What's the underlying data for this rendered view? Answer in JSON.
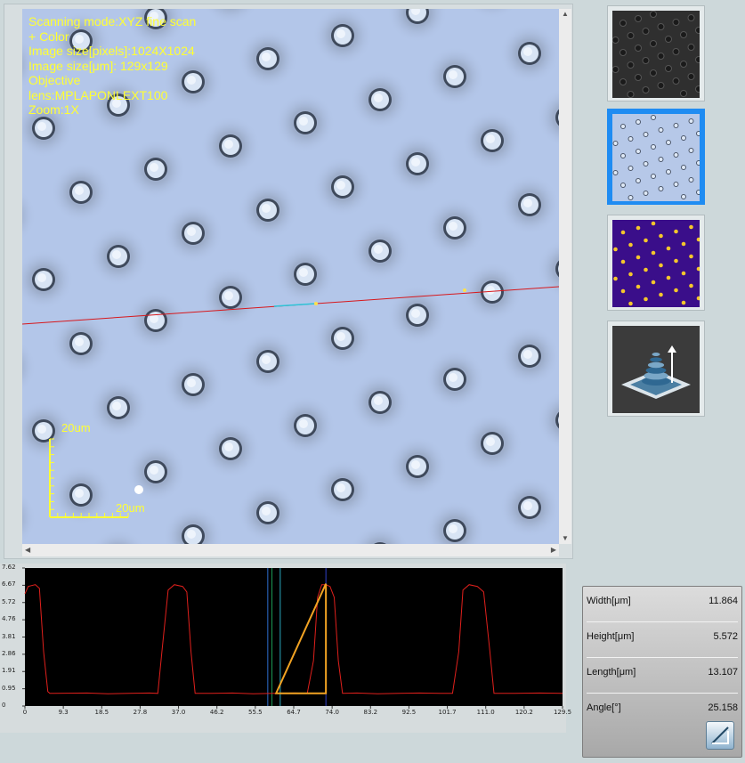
{
  "viewer": {
    "info_text": "Scanning mode:XYZ fine scan\n+ Color\nImage size[pixels]:1024X1024\nImage size[μm]: 129x129\nObjective\nlens:MPLAPONLEXT100\nZoom:1X",
    "scale_bar_vertical_label": "20um",
    "scale_bar_horizontal_label": "20um"
  },
  "thumbnails": [
    {
      "name": "grayscale-intensity-image",
      "selected": false
    },
    {
      "name": "color-optical-image",
      "selected": true
    },
    {
      "name": "height-map-image",
      "selected": false
    },
    {
      "name": "3d-view-icon",
      "selected": false
    }
  ],
  "measurements": [
    {
      "label": "Width[μm]",
      "value": "11.864"
    },
    {
      "label": "Height[μm]",
      "value": "5.572"
    },
    {
      "label": "Length[μm]",
      "value": "13.107"
    },
    {
      "label": "Angle[°]",
      "value": "25.158"
    }
  ],
  "chart_data": {
    "type": "line",
    "title": "",
    "xlabel": "",
    "ylabel": "",
    "xlim": [
      0,
      129.5
    ],
    "ylim": [
      0,
      7.62
    ],
    "x_ticks": [
      "0",
      "9.3",
      "18.5",
      "27.8",
      "37.0",
      "46.2",
      "55.5",
      "64.7",
      "74.0",
      "83.2",
      "92.5",
      "101.7",
      "111.0",
      "120.2",
      "129.5"
    ],
    "y_ticks": [
      "0",
      "0.95",
      "1.91",
      "2.86",
      "3.81",
      "4.76",
      "5.72",
      "6.67",
      "7.62"
    ],
    "series": [
      {
        "color": "#e0201c",
        "x": [
          0,
          0.8,
          2.5,
          3.5,
          4.5,
          5.5,
          6.0,
          7.0,
          15,
          20,
          25,
          30,
          32.0,
          33.0,
          34.5,
          36,
          38,
          39.0,
          40.0,
          41.0,
          45,
          50,
          55,
          60,
          65,
          68.0,
          69.5,
          70.5,
          71.5,
          72.5,
          73.5,
          74.5,
          75.5,
          76.5,
          80,
          85,
          90,
          95,
          100,
          103,
          104.5,
          105.5,
          107,
          109,
          110.5,
          112.0,
          113.0,
          118,
          124,
          129.5
        ],
        "y": [
          6.2,
          6.6,
          6.7,
          6.5,
          3.0,
          0.8,
          0.7,
          0.7,
          0.72,
          0.68,
          0.7,
          0.72,
          0.7,
          3.0,
          6.4,
          6.7,
          6.6,
          6.3,
          3.0,
          0.7,
          0.7,
          0.72,
          0.68,
          0.7,
          0.72,
          0.7,
          2.5,
          6.0,
          6.7,
          6.7,
          6.6,
          6.0,
          2.5,
          0.7,
          0.72,
          0.68,
          0.7,
          0.72,
          0.7,
          0.7,
          3.0,
          6.4,
          6.7,
          6.6,
          6.3,
          3.0,
          0.7,
          0.7,
          0.72,
          0.7
        ]
      }
    ],
    "cursor_lines_x": [
      58.5,
      59.5,
      61.5,
      72.5
    ],
    "triangle": {
      "color": "#f2a323",
      "x_start": 60.5,
      "x_end": 72.5,
      "y_low": 0.7,
      "y_high": 6.75
    }
  }
}
